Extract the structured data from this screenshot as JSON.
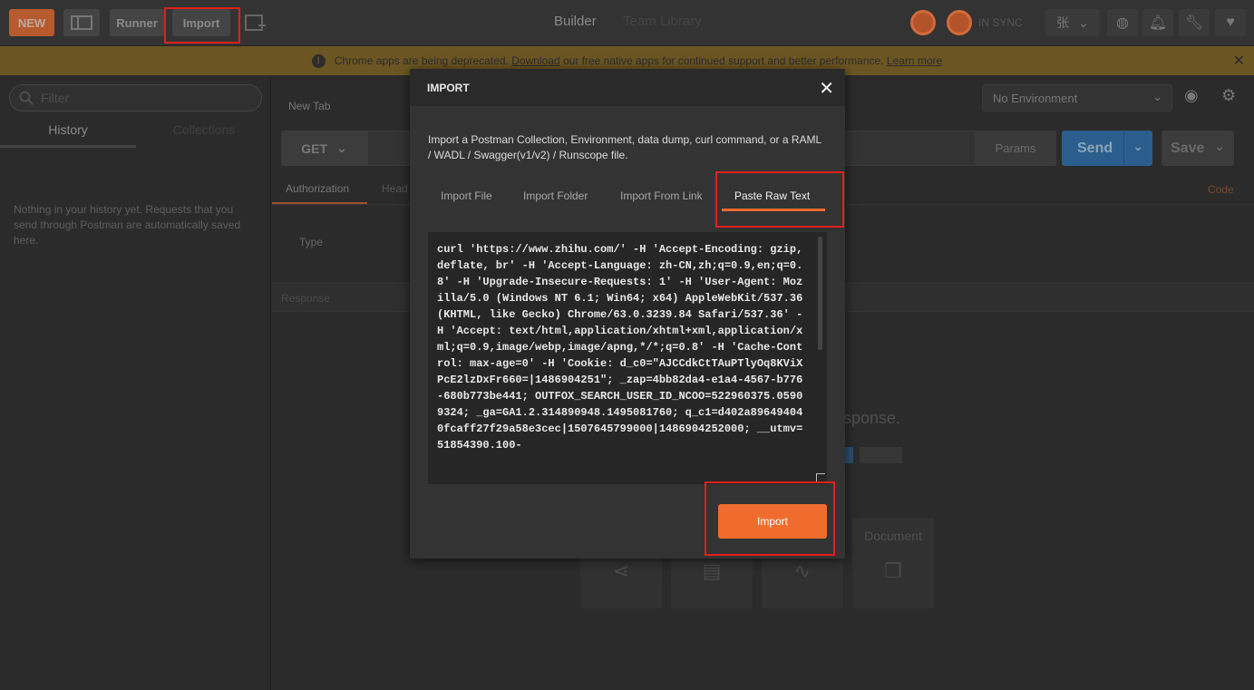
{
  "topbar": {
    "new_label": "NEW",
    "runner_label": "Runner",
    "import_label": "Import",
    "builder_label": "Builder",
    "team_library_label": "Team Library",
    "sync_label": "IN SYNC",
    "user_label": "张"
  },
  "banner": {
    "text_before": "Chrome apps are being deprecated.",
    "download_link": "Download",
    "text_after": "our free native apps for continued support and better performance.",
    "learn_more_link": "Learn more",
    "close_glyph": "✕"
  },
  "sidebar": {
    "search_placeholder": "Filter",
    "tabs": [
      {
        "label": "History"
      },
      {
        "label": "Collections"
      }
    ],
    "history_empty": "Nothing in your history yet. Requests that you send through Postman are automatically saved here."
  },
  "main": {
    "tab_label": "New Tab",
    "environment": "No Environment",
    "method": "GET",
    "params_label": "Params",
    "send_label": "Send",
    "save_label": "Save",
    "request_tabs": [
      {
        "label": "Authorization"
      },
      {
        "label": "Head"
      }
    ],
    "code_label": "Code",
    "type_label": "Type",
    "response_label": "Response",
    "response_hint": "sponse.",
    "document_label": "Document"
  },
  "modal": {
    "title": "IMPORT",
    "close_glyph": "✕",
    "description": "Import a Postman Collection, Environment, data dump, curl command, or a RAML / WADL / Swagger(v1/v2) / Runscope file.",
    "tabs": [
      {
        "label": "Import File"
      },
      {
        "label": "Import Folder"
      },
      {
        "label": "Import From Link"
      },
      {
        "label": "Paste Raw Text"
      }
    ],
    "active_tab": "Paste Raw Text",
    "raw_text": "curl 'https://www.zhihu.com/' -H 'Accept-Encoding: gzip, deflate, br' -H 'Accept-Language: zh-CN,zh;q=0.9,en;q=0.8' -H 'Upgrade-Insecure-Requests: 1' -H 'User-Agent: Mozilla/5.0 (Windows NT 6.1; Win64; x64) AppleWebKit/537.36 (KHTML, like Gecko) Chrome/63.0.3239.84 Safari/537.36' -H 'Accept: text/html,application/xhtml+xml,application/xml;q=0.9,image/webp,image/apng,*/*;q=0.8' -H 'Cache-Control: max-age=0' -H 'Cookie: d_c0=\"AJCCdkCtTAuPTlyOq8KViXPcE2lzDxFr660=|1486904251\"; _zap=4bb82da4-e1a4-4567-b776-680b773be441; OUTFOX_SEARCH_USER_ID_NCOO=522960375.05909324; _ga=GA1.2.314890948.1495081760; q_c1=d402a896494040fcaff27f29a58e3cec|1507645799000|1486904252000; __utmv=51854390.100-",
    "import_button": "Import"
  },
  "colors": {
    "accent": "#ef6c2e",
    "send_blue": "#2b5e8c",
    "highlight_red": "#e2201b",
    "banner": "#6b5522"
  }
}
